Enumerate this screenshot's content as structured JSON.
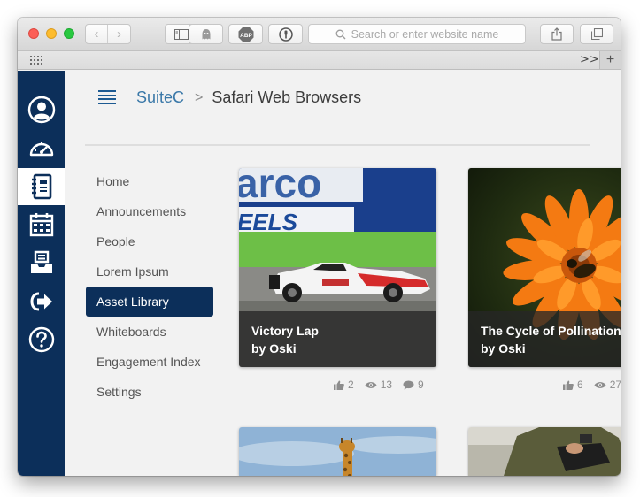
{
  "browser": {
    "address_placeholder": "Search or enter website name",
    "icons": [
      "back-icon",
      "forward-icon",
      "sidebar-icon",
      "ghostery-icon",
      "adblock-icon",
      "password-icon",
      "search-icon",
      "share-icon",
      "tabs-icon",
      "favorites-grid-icon",
      "more-icon",
      "new-tab-icon"
    ],
    "adblock_label": "ABP",
    "new_tab_label": "+",
    "more_label": ">>"
  },
  "app": {
    "brand_color": "#0c2f5a",
    "link_color": "#3a78a8",
    "left_nav": [
      {
        "name": "user-icon",
        "active": false
      },
      {
        "name": "dashboard-icon",
        "active": false
      },
      {
        "name": "notebook-icon",
        "active": true
      },
      {
        "name": "calendar-icon",
        "active": false
      },
      {
        "name": "inbox-icon",
        "active": false
      },
      {
        "name": "sign-out-icon",
        "active": false
      },
      {
        "name": "help-icon",
        "active": false
      }
    ]
  },
  "breadcrumb": {
    "root": "SuiteC",
    "separator": ">",
    "current": "Safari Web Browsers"
  },
  "menu": {
    "items": [
      "Home",
      "Announcements",
      "People",
      "Lorem Ipsum",
      "Asset Library",
      "Whiteboards",
      "Engagement Index",
      "Settings"
    ],
    "active": "Asset Library"
  },
  "assets": [
    {
      "title": "Victory Lap",
      "author": "by Oski",
      "likes": "2",
      "views": "13",
      "comments": "9"
    },
    {
      "title": "The Cycle of Pollination",
      "author": "by Oski",
      "likes": "6",
      "views": "27",
      "comments": ""
    }
  ]
}
